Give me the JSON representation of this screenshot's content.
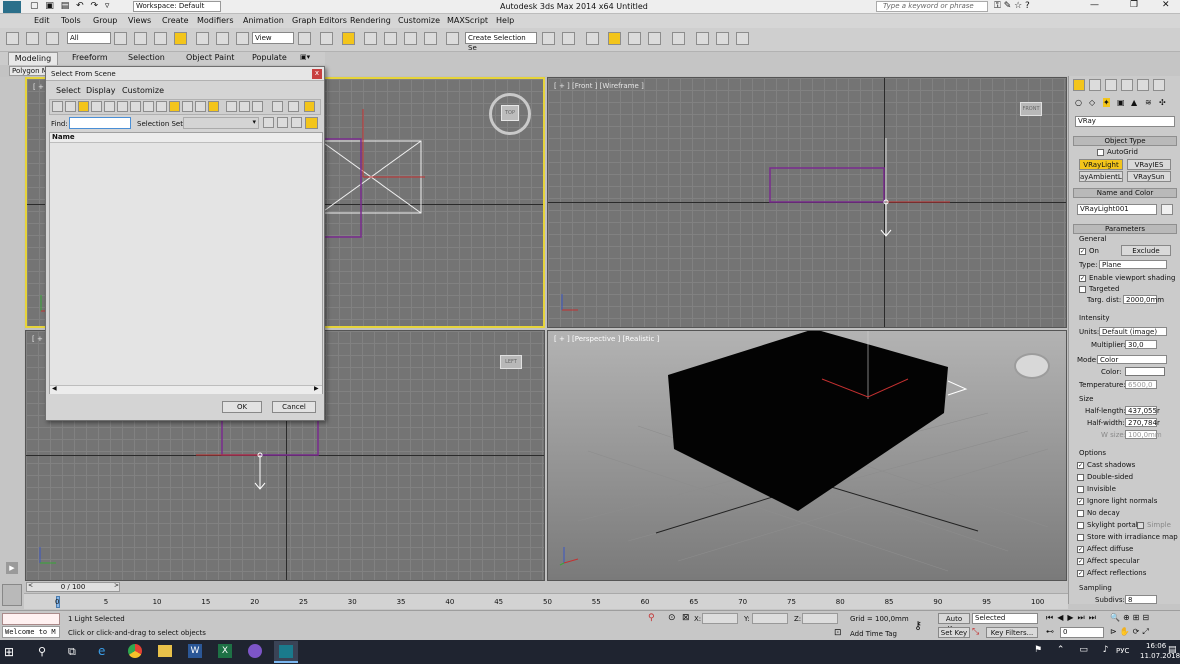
{
  "window": {
    "title": "Autodesk 3ds Max  2014 x64      Untitled",
    "workspace": "Workspace: Default",
    "search_placeholder": "Type a keyword or phrase"
  },
  "menu": [
    "Edit",
    "Tools",
    "Group",
    "Views",
    "Create",
    "Modifiers",
    "Animation",
    "Graph Editors",
    "Rendering",
    "Customize",
    "MAXScript",
    "Help"
  ],
  "toolbar": {
    "filter": "All",
    "view": "View",
    "selection_set": "Create Selection Se"
  },
  "ribbon": {
    "tabs": [
      "Modeling",
      "Freeform",
      "Selection",
      "Object Paint",
      "Populate"
    ],
    "sub": "Polygon M"
  },
  "viewports": {
    "top": {
      "label": "[ + ]",
      "cube": "TOP"
    },
    "front": {
      "label": "[ + ] [Front ] [Wireframe ]",
      "cube": "FRONT"
    },
    "left": {
      "label": "[ + ]",
      "cube": "LEFT"
    },
    "persp": {
      "label": "[ + ] [Perspective ] [Realistic ]"
    }
  },
  "dialog": {
    "title": "Select From Scene",
    "close": "x",
    "menu": [
      "Select",
      "Display",
      "Customize"
    ],
    "find_label": "Find:",
    "find_value": "",
    "selection_set_label": "Selection Set:",
    "column_name": "Name",
    "ok": "OK",
    "cancel": "Cancel"
  },
  "cmd": {
    "category": "VRay",
    "object_type_head": "Object Type",
    "autogrid": "AutoGrid",
    "buttons": [
      "VRayLight",
      "VRayIES",
      "ayAmbientLig",
      "VRaySun"
    ],
    "name_color_head": "Name and Color",
    "object_name": "VRayLight001",
    "parameters_head": "Parameters",
    "general": "General",
    "on": "On",
    "exclude": "Exclude",
    "type_label": "Type:",
    "type_value": "Plane",
    "enable_shading": "Enable viewport shading",
    "targeted": "Targeted",
    "targ_dist_label": "Targ. dist:",
    "targ_dist": "2000,0mm",
    "intensity": "Intensity",
    "units_label": "Units:",
    "units_value": "Default (image)",
    "multiplier_label": "Multiplier:",
    "multiplier": "30,0",
    "mode_label": "Mode:",
    "mode_value": "Color",
    "color_label": "Color:",
    "temperature_label": "Temperature:",
    "temperature": "6500,0",
    "size": "Size",
    "half_length_label": "Half-length:",
    "half_length": "437,055r",
    "half_width_label": "Half-width:",
    "half_width": "270,784r",
    "w_size_label": "W size:",
    "w_size": "100,0mm",
    "options": "Options",
    "option_items": [
      {
        "label": "Cast shadows",
        "checked": "✓"
      },
      {
        "label": "Double-sided",
        "checked": ""
      },
      {
        "label": "Invisible",
        "checked": ""
      },
      {
        "label": "Ignore light normals",
        "checked": "✓"
      },
      {
        "label": "No decay",
        "checked": ""
      },
      {
        "label": "Skylight portal",
        "checked": ""
      },
      {
        "label": "Store with irradiance map",
        "checked": ""
      },
      {
        "label": "Affect diffuse",
        "checked": "✓"
      },
      {
        "label": "Affect specular",
        "checked": "✓"
      },
      {
        "label": "Affect reflections",
        "checked": "✓"
      }
    ],
    "simple": "Simple",
    "sampling": "Sampling",
    "subdivs_label": "Subdivs:",
    "subdivs": "8"
  },
  "timeline": {
    "frame": "0 / 100",
    "ticks": [
      "0",
      "5",
      "10",
      "15",
      "20",
      "25",
      "30",
      "35",
      "40",
      "45",
      "50",
      "55",
      "60",
      "65",
      "70",
      "75",
      "80",
      "85",
      "90",
      "95",
      "100"
    ]
  },
  "status": {
    "maxscript": "Welcome to M",
    "selected": "1 Light Selected",
    "prompt": "Click or click-and-drag to select objects",
    "x": "X:",
    "y": "Y:",
    "z": "Z:",
    "grid": "Grid = 100,0mm",
    "add_time_tag": "Add Time Tag",
    "auto_key": "Auto Key",
    "set_key": "Set Key",
    "selected_dd": "Selected",
    "key_filters": "Key Filters...",
    "frame": "0"
  },
  "taskbar": {
    "lang": "РУС",
    "time": "16:06",
    "date": "11.07.2018"
  },
  "colors": {
    "viewport_active": "#e6d43a",
    "accent": "#f3c51b"
  }
}
